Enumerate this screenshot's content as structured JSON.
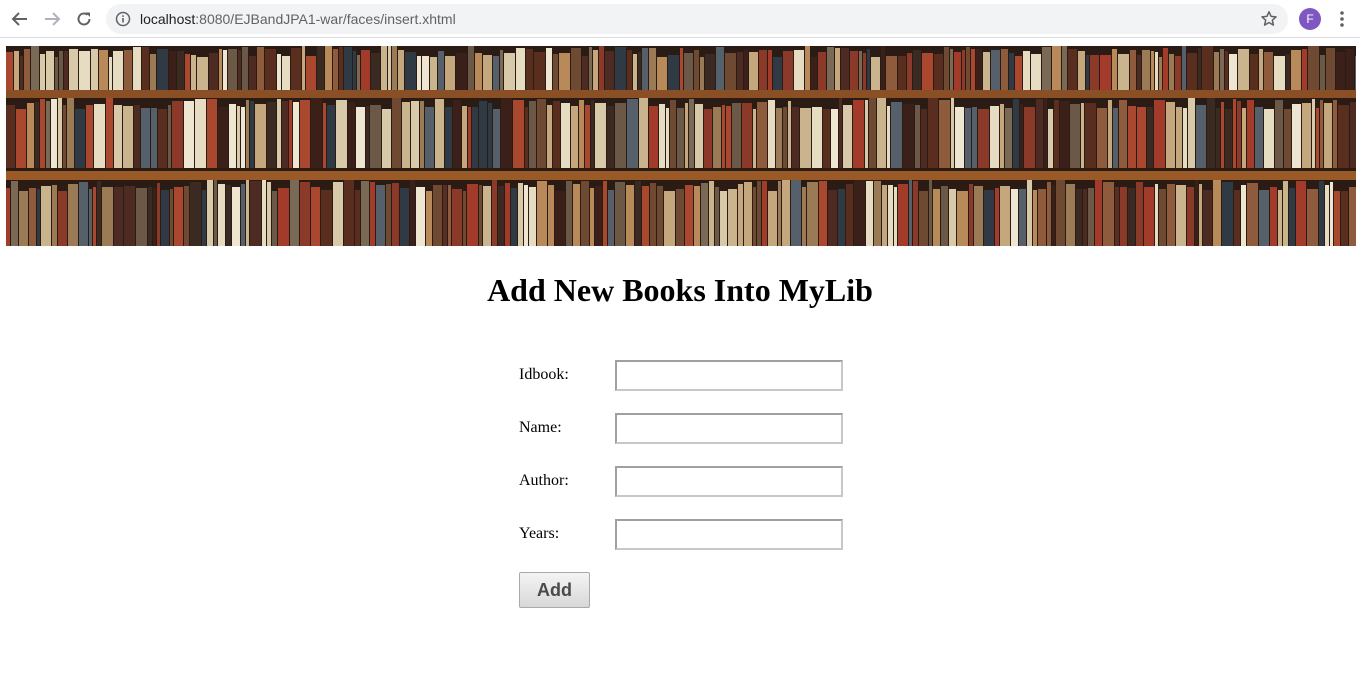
{
  "browser": {
    "url_host": "localhost",
    "url_rest": ":8080/EJBandJPA1-war/faces/insert.xhtml",
    "avatar_letter": "F",
    "avatar_color": "#7e57c2"
  },
  "page": {
    "title": "Add New Books Into MyLib"
  },
  "form": {
    "fields": [
      {
        "label": "Idbook:",
        "value": ""
      },
      {
        "label": "Name:",
        "value": ""
      },
      {
        "label": "Author:",
        "value": ""
      },
      {
        "label": "Years:",
        "value": ""
      }
    ],
    "submit_label": "Add"
  }
}
